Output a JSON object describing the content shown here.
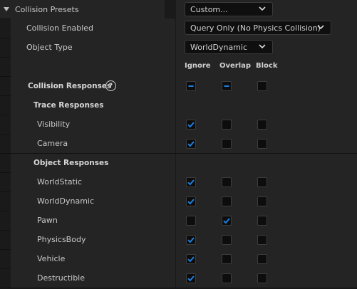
{
  "presets": {
    "label": "Collision Presets",
    "value": "Custom..."
  },
  "collision_enabled": {
    "label": "Collision Enabled",
    "value": "Query Only (No Physics Collision)"
  },
  "object_type": {
    "label": "Object Type",
    "value": "WorldDynamic"
  },
  "columns": {
    "ignore": "Ignore",
    "overlap": "Overlap",
    "block": "Block"
  },
  "collision_responses": {
    "label": "Collision Responses",
    "help_glyph": "?",
    "ignore": "mixed",
    "overlap": "mixed",
    "block": "unchecked"
  },
  "trace_header": "Trace Responses",
  "trace_rows": [
    {
      "label": "Visibility",
      "ignore": true,
      "overlap": false,
      "block": false
    },
    {
      "label": "Camera",
      "ignore": true,
      "overlap": false,
      "block": false
    }
  ],
  "object_header": "Object Responses",
  "object_rows": [
    {
      "label": "WorldStatic",
      "ignore": true,
      "overlap": false,
      "block": false
    },
    {
      "label": "WorldDynamic",
      "ignore": true,
      "overlap": false,
      "block": false
    },
    {
      "label": "Pawn",
      "ignore": false,
      "overlap": true,
      "block": false
    },
    {
      "label": "PhysicsBody",
      "ignore": true,
      "overlap": false,
      "block": false
    },
    {
      "label": "Vehicle",
      "ignore": true,
      "overlap": false,
      "block": false
    },
    {
      "label": "Destructible",
      "ignore": true,
      "overlap": false,
      "block": false
    }
  ],
  "colors": {
    "check": "#1e7fe0",
    "panel": "#242424",
    "field": "#0f0f0f"
  },
  "icons": {
    "expand": "triangle-down-icon",
    "dropdown": "chevron-down-icon",
    "help": "question-circle-icon",
    "check": "checkmark-icon",
    "mixed": "minus-icon"
  }
}
